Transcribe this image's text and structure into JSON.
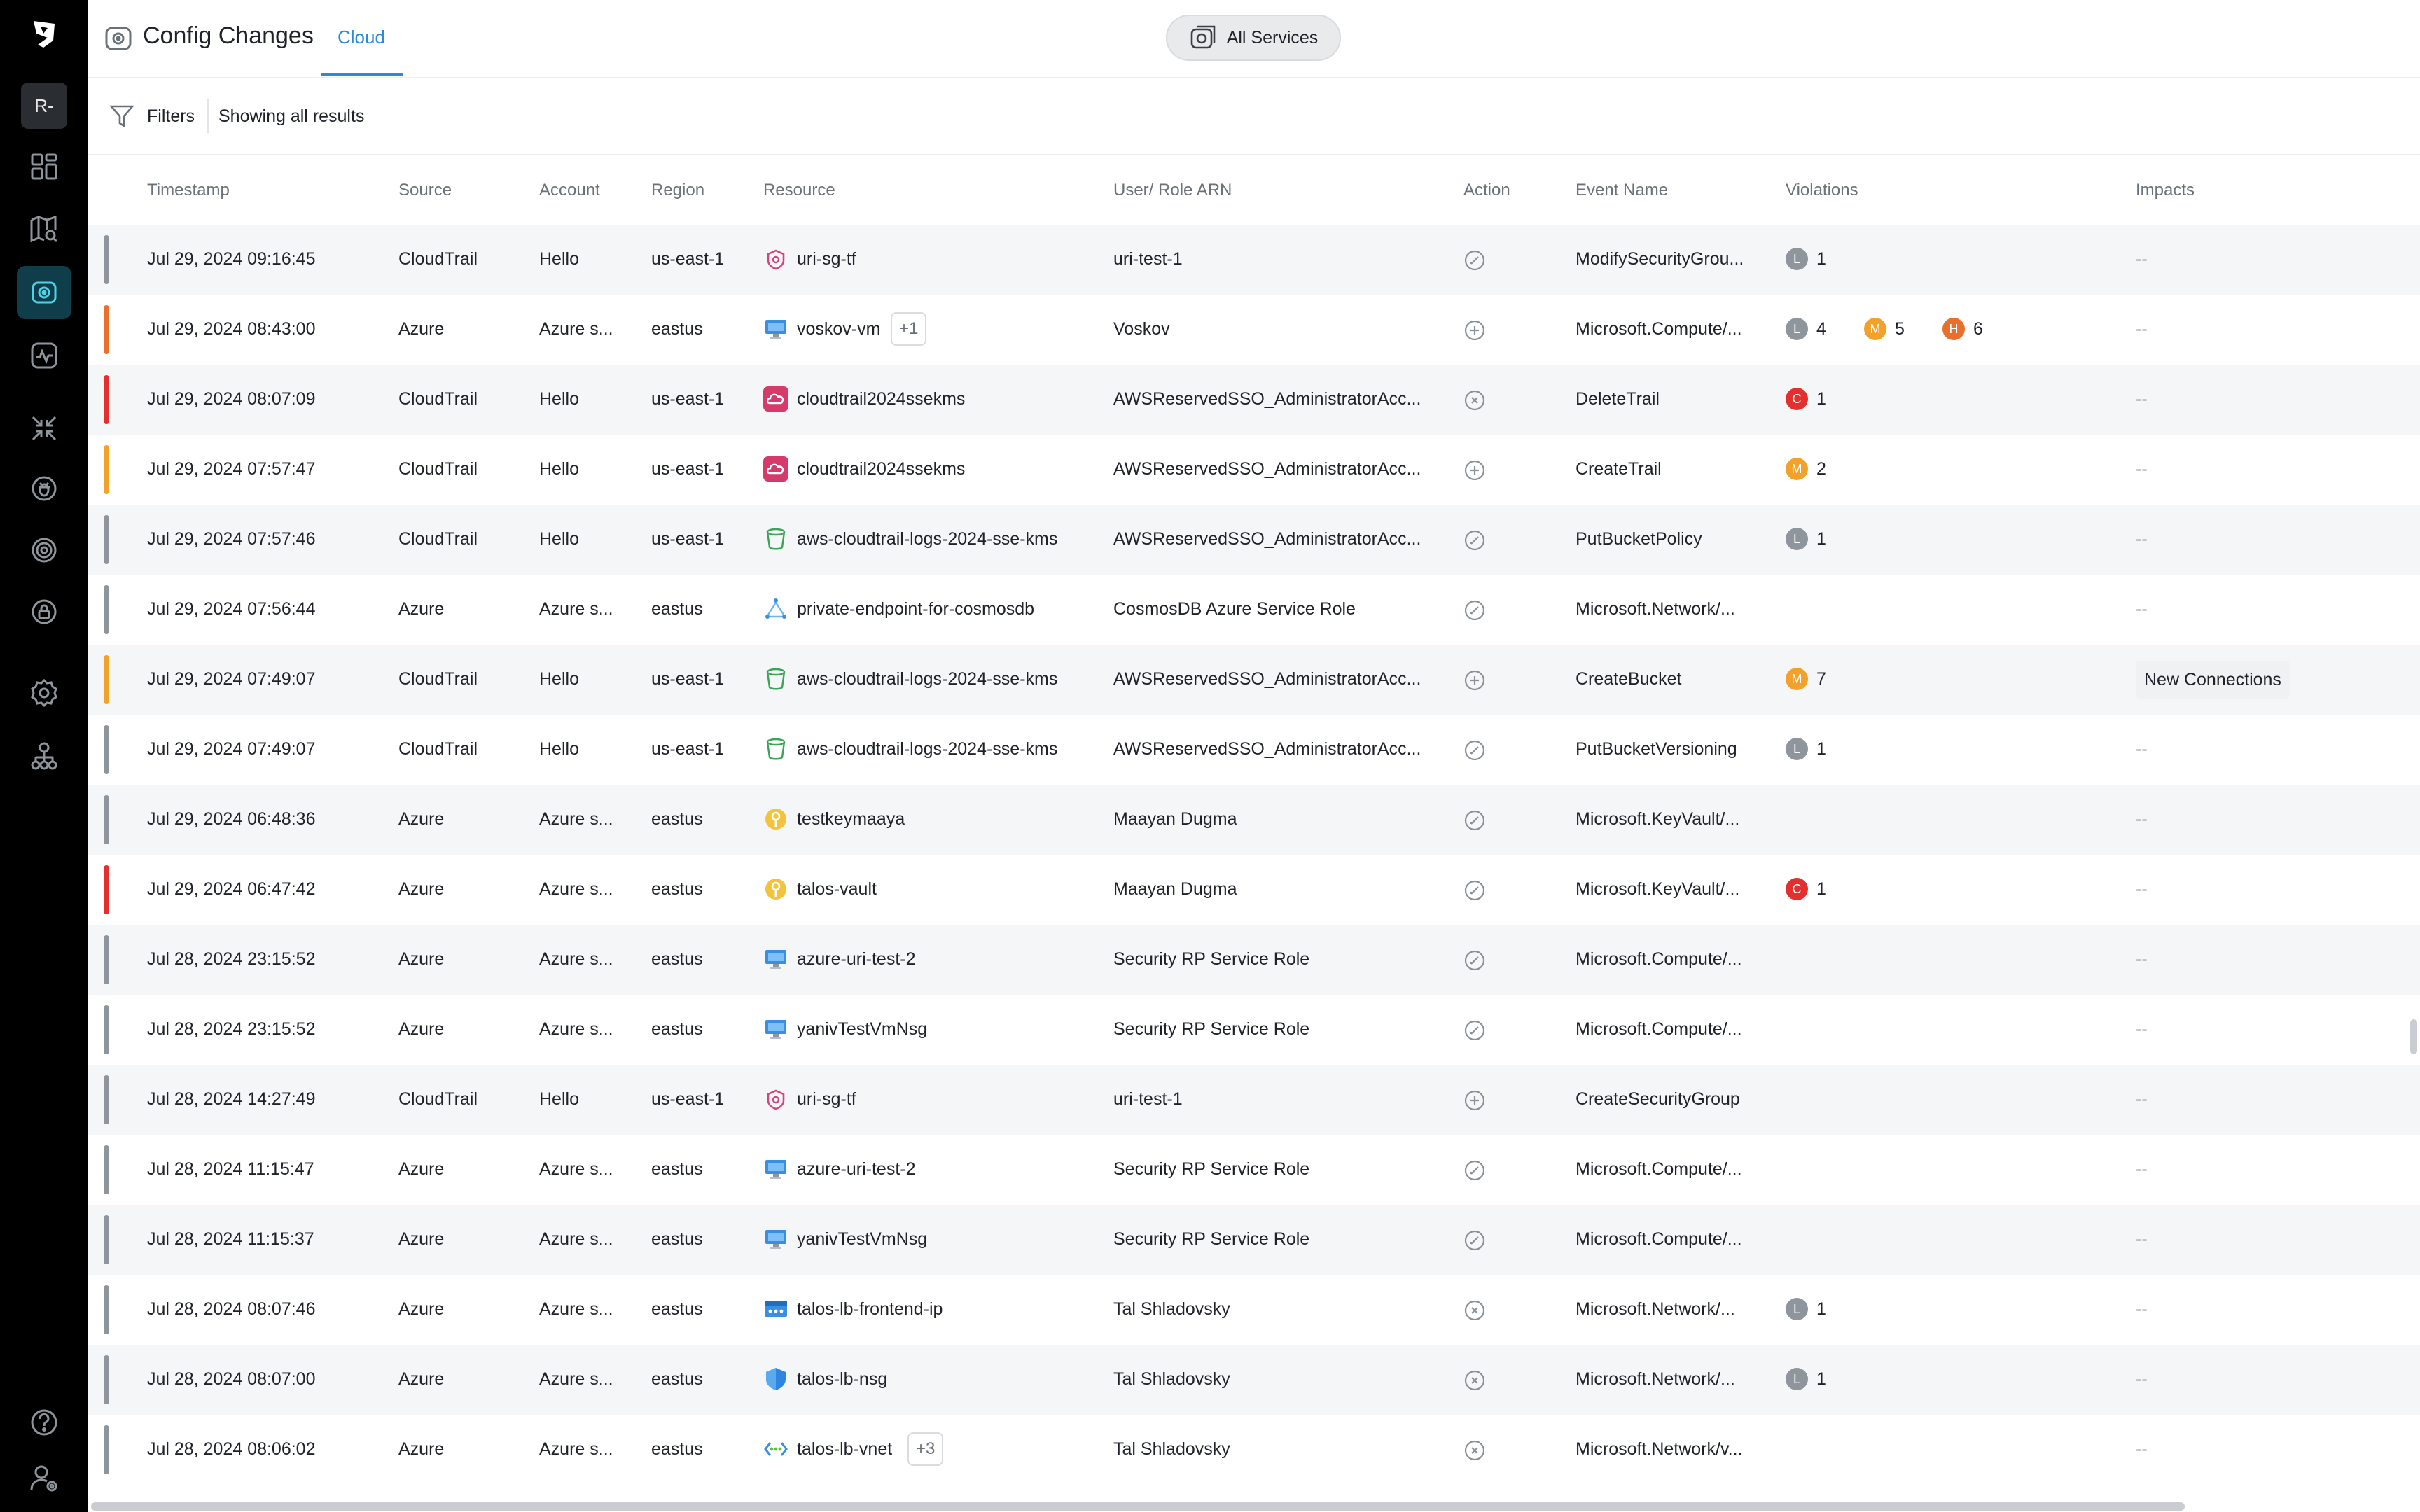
{
  "sidebar": {
    "tenant": "R-",
    "items": [
      {
        "name": "dashboard-icon"
      },
      {
        "name": "map-search-icon"
      },
      {
        "name": "config-changes-icon",
        "active": true
      },
      {
        "name": "activity-icon"
      },
      {
        "name": "collapse-arrows-icon"
      },
      {
        "name": "bug-icon"
      },
      {
        "name": "radar-icon"
      },
      {
        "name": "lock-icon"
      },
      {
        "name": "settings-icon"
      },
      {
        "name": "org-chart-icon"
      },
      {
        "name": "help-icon"
      },
      {
        "name": "user-settings-icon"
      }
    ]
  },
  "header": {
    "title": "Config Changes",
    "tab": "Cloud",
    "services_label": "All Services"
  },
  "filterbar": {
    "filters_label": "Filters",
    "showing": "Showing all results"
  },
  "colors": {
    "accent": "#2c8ad8",
    "severity_low": "#8e959d",
    "severity_medium": "#f2a12a",
    "severity_high": "#ea6f2c",
    "severity_critical": "#e3302f"
  },
  "table": {
    "columns": [
      "Timestamp",
      "Source",
      "Account",
      "Region",
      "Resource",
      "User/ Role ARN",
      "Action",
      "Event Name",
      "Violations",
      "Impacts"
    ],
    "rows": [
      {
        "bar": "#8e959d",
        "timestamp": "Jul 29, 2024 09:16:45",
        "source": "CloudTrail",
        "account": "Hello",
        "region": "us-east-1",
        "resource": "uri-sg-tf",
        "res_icon": "security-group-icon",
        "extra": "",
        "user": "uri-test-1",
        "action": "modify",
        "event": "ModifySecurityGrou...",
        "violations": [
          {
            "sev": "L",
            "count": "1"
          }
        ],
        "impacts": "--"
      },
      {
        "bar": "#ea6f2c",
        "timestamp": "Jul 29, 2024 08:43:00",
        "source": "Azure",
        "account": "Azure s...",
        "region": "eastus",
        "resource": "voskov-vm",
        "res_icon": "virtual-machine-icon",
        "extra": "+1",
        "user": "Voskov",
        "action": "create",
        "event": "Microsoft.Compute/...",
        "violations": [
          {
            "sev": "L",
            "count": "4"
          },
          {
            "sev": "M",
            "count": "5"
          },
          {
            "sev": "H",
            "count": "6"
          }
        ],
        "impacts": "--"
      },
      {
        "bar": "#e3302f",
        "timestamp": "Jul 29, 2024 08:07:09",
        "source": "CloudTrail",
        "account": "Hello",
        "region": "us-east-1",
        "resource": "cloudtrail2024ssekms",
        "res_icon": "cloudtrail-icon",
        "extra": "",
        "user": "AWSReservedSSO_AdministratorAcc...",
        "action": "delete",
        "event": "DeleteTrail",
        "violations": [
          {
            "sev": "C",
            "count": "1"
          }
        ],
        "impacts": "--"
      },
      {
        "bar": "#f2a12a",
        "timestamp": "Jul 29, 2024 07:57:47",
        "source": "CloudTrail",
        "account": "Hello",
        "region": "us-east-1",
        "resource": "cloudtrail2024ssekms",
        "res_icon": "cloudtrail-icon",
        "extra": "",
        "user": "AWSReservedSSO_AdministratorAcc...",
        "action": "create",
        "event": "CreateTrail",
        "violations": [
          {
            "sev": "M",
            "count": "2"
          }
        ],
        "impacts": "--"
      },
      {
        "bar": "#8e959d",
        "timestamp": "Jul 29, 2024 07:57:46",
        "source": "CloudTrail",
        "account": "Hello",
        "region": "us-east-1",
        "resource": "aws-cloudtrail-logs-2024-sse-kms",
        "res_icon": "s3-bucket-icon",
        "extra": "",
        "user": "AWSReservedSSO_AdministratorAcc...",
        "action": "modify",
        "event": "PutBucketPolicy",
        "violations": [
          {
            "sev": "L",
            "count": "1"
          }
        ],
        "impacts": "--"
      },
      {
        "bar": "#8e959d",
        "timestamp": "Jul 29, 2024 07:56:44",
        "source": "Azure",
        "account": "Azure s...",
        "region": "eastus",
        "resource": "private-endpoint-for-cosmosdb",
        "res_icon": "private-endpoint-icon",
        "extra": "",
        "user": "CosmosDB Azure Service Role",
        "action": "modify",
        "event": "Microsoft.Network/...",
        "violations": [],
        "impacts": "--"
      },
      {
        "bar": "#f2a12a",
        "timestamp": "Jul 29, 2024 07:49:07",
        "source": "CloudTrail",
        "account": "Hello",
        "region": "us-east-1",
        "resource": "aws-cloudtrail-logs-2024-sse-kms",
        "res_icon": "s3-bucket-icon",
        "extra": "",
        "user": "AWSReservedSSO_AdministratorAcc...",
        "action": "create",
        "event": "CreateBucket",
        "violations": [
          {
            "sev": "M",
            "count": "7"
          }
        ],
        "impacts": "New Connections"
      },
      {
        "bar": "#8e959d",
        "timestamp": "Jul 29, 2024 07:49:07",
        "source": "CloudTrail",
        "account": "Hello",
        "region": "us-east-1",
        "resource": "aws-cloudtrail-logs-2024-sse-kms",
        "res_icon": "s3-bucket-icon",
        "extra": "",
        "user": "AWSReservedSSO_AdministratorAcc...",
        "action": "modify",
        "event": "PutBucketVersioning",
        "violations": [
          {
            "sev": "L",
            "count": "1"
          }
        ],
        "impacts": "--"
      },
      {
        "bar": "#8e959d",
        "timestamp": "Jul 29, 2024 06:48:36",
        "source": "Azure",
        "account": "Azure s...",
        "region": "eastus",
        "resource": "testkeymaaya",
        "res_icon": "key-vault-icon",
        "extra": "",
        "user": "Maayan Dugma",
        "action": "modify",
        "event": "Microsoft.KeyVault/...",
        "violations": [],
        "impacts": "--"
      },
      {
        "bar": "#e3302f",
        "timestamp": "Jul 29, 2024 06:47:42",
        "source": "Azure",
        "account": "Azure s...",
        "region": "eastus",
        "resource": "talos-vault",
        "res_icon": "key-vault-icon",
        "extra": "",
        "user": "Maayan Dugma",
        "action": "modify",
        "event": "Microsoft.KeyVault/...",
        "violations": [
          {
            "sev": "C",
            "count": "1"
          }
        ],
        "impacts": "--"
      },
      {
        "bar": "#8e959d",
        "timestamp": "Jul 28, 2024 23:15:52",
        "source": "Azure",
        "account": "Azure s...",
        "region": "eastus",
        "resource": "azure-uri-test-2",
        "res_icon": "virtual-machine-icon",
        "extra": "",
        "user": "Security RP Service Role",
        "action": "modify",
        "event": "Microsoft.Compute/...",
        "violations": [],
        "impacts": "--"
      },
      {
        "bar": "#8e959d",
        "timestamp": "Jul 28, 2024 23:15:52",
        "source": "Azure",
        "account": "Azure s...",
        "region": "eastus",
        "resource": "yanivTestVmNsg",
        "res_icon": "virtual-machine-icon",
        "extra": "",
        "user": "Security RP Service Role",
        "action": "modify",
        "event": "Microsoft.Compute/...",
        "violations": [],
        "impacts": "--"
      },
      {
        "bar": "#8e959d",
        "timestamp": "Jul 28, 2024 14:27:49",
        "source": "CloudTrail",
        "account": "Hello",
        "region": "us-east-1",
        "resource": "uri-sg-tf",
        "res_icon": "security-group-icon",
        "extra": "",
        "user": "uri-test-1",
        "action": "create",
        "event": "CreateSecurityGroup",
        "violations": [],
        "impacts": "--"
      },
      {
        "bar": "#8e959d",
        "timestamp": "Jul 28, 2024 11:15:47",
        "source": "Azure",
        "account": "Azure s...",
        "region": "eastus",
        "resource": "azure-uri-test-2",
        "res_icon": "virtual-machine-icon",
        "extra": "",
        "user": "Security RP Service Role",
        "action": "modify",
        "event": "Microsoft.Compute/...",
        "violations": [],
        "impacts": "--"
      },
      {
        "bar": "#8e959d",
        "timestamp": "Jul 28, 2024 11:15:37",
        "source": "Azure",
        "account": "Azure s...",
        "region": "eastus",
        "resource": "yanivTestVmNsg",
        "res_icon": "virtual-machine-icon",
        "extra": "",
        "user": "Security RP Service Role",
        "action": "modify",
        "event": "Microsoft.Compute/...",
        "violations": [],
        "impacts": "--"
      },
      {
        "bar": "#8e959d",
        "timestamp": "Jul 28, 2024 08:07:46",
        "source": "Azure",
        "account": "Azure s...",
        "region": "eastus",
        "resource": "talos-lb-frontend-ip",
        "res_icon": "frontend-ip-icon",
        "extra": "",
        "user": "Tal Shladovsky",
        "action": "delete",
        "event": "Microsoft.Network/...",
        "violations": [
          {
            "sev": "L",
            "count": "1"
          }
        ],
        "impacts": "--"
      },
      {
        "bar": "#8e959d",
        "timestamp": "Jul 28, 2024 08:07:00",
        "source": "Azure",
        "account": "Azure s...",
        "region": "eastus",
        "resource": "talos-lb-nsg",
        "res_icon": "nsg-shield-icon",
        "extra": "",
        "user": "Tal Shladovsky",
        "action": "delete",
        "event": "Microsoft.Network/...",
        "violations": [
          {
            "sev": "L",
            "count": "1"
          }
        ],
        "impacts": "--"
      },
      {
        "bar": "#8e959d",
        "timestamp": "Jul 28, 2024 08:06:02",
        "source": "Azure",
        "account": "Azure s...",
        "region": "eastus",
        "resource": "talos-lb-vnet",
        "res_icon": "vnet-icon",
        "extra": "+3",
        "user": "Tal Shladovsky",
        "action": "delete",
        "event": "Microsoft.Network/v...",
        "violations": [],
        "impacts": "--"
      }
    ]
  }
}
